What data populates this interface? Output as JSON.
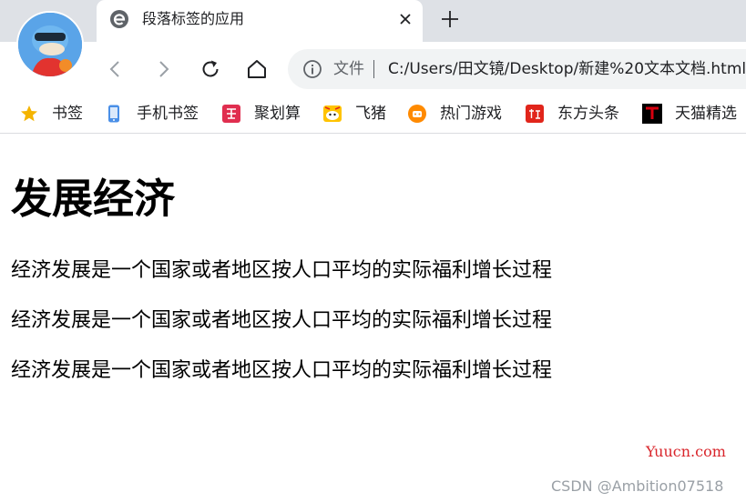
{
  "browser": {
    "tab": {
      "title": "段落标签的应用",
      "favicon": "edge-e-icon",
      "close": "close-icon"
    },
    "new_tab": "plus-icon",
    "avatar": "profile-avatar",
    "nav": {
      "back": "back-arrow-icon",
      "forward": "forward-arrow-icon",
      "reload": "reload-icon",
      "home": "home-icon"
    },
    "address": {
      "info_icon": "info-icon",
      "scheme_label": "文件",
      "url": "C:/Users/田文镜/Desktop/新建%20文本文档.html"
    },
    "bookmarks": [
      {
        "label": "书签",
        "icon": "star-icon",
        "color": "#f4b400"
      },
      {
        "label": "手机书签",
        "icon": "phone-icon",
        "color": "#4a8fe7"
      },
      {
        "label": "聚划算",
        "icon": "juhuasuan-icon",
        "color": "#e02e4f"
      },
      {
        "label": "飞猪",
        "icon": "fliggy-icon",
        "color": "#ffc300"
      },
      {
        "label": "热门游戏",
        "icon": "game-icon",
        "color": "#ff8a00"
      },
      {
        "label": "东方头条",
        "icon": "dongfang-icon",
        "color": "#e1251b"
      },
      {
        "label": "天猫精选",
        "icon": "tmall-icon",
        "color": "#d7000f"
      }
    ]
  },
  "page": {
    "heading": "发展经济",
    "paragraphs": [
      "经济发展是一个国家或者地区按人口平均的实际福利增长过程",
      "经济发展是一个国家或者地区按人口平均的实际福利增长过程",
      "经济发展是一个国家或者地区按人口平均的实际福利增长过程"
    ]
  },
  "watermarks": {
    "yuucn": "Yuucn.com",
    "csdn": "CSDN @Ambition07518"
  }
}
